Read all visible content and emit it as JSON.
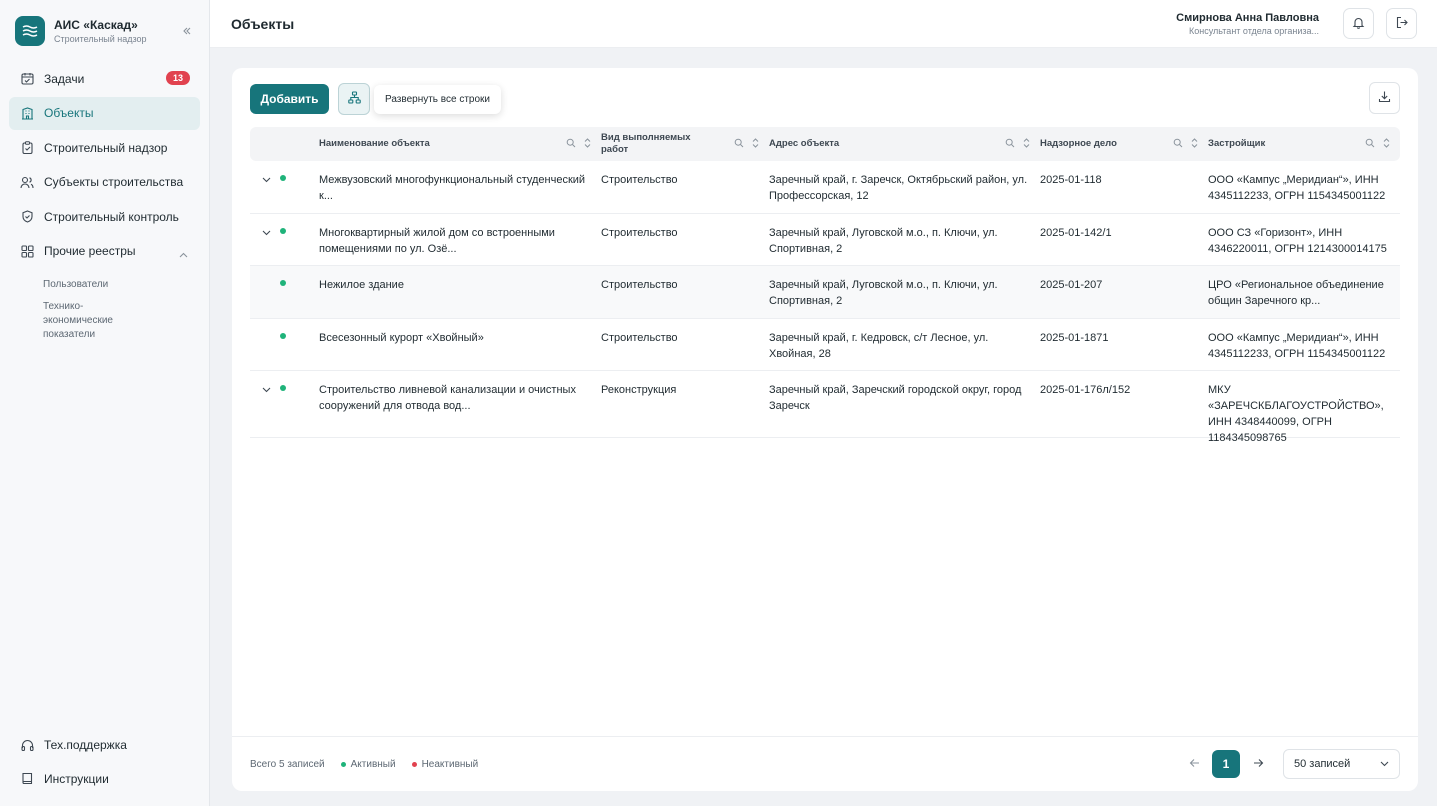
{
  "brand": {
    "title": "АИС «Каскад»",
    "subtitle": "Строительный надзор"
  },
  "sidebar": {
    "items": [
      {
        "label": "Задачи",
        "icon": "calendar-check-icon",
        "badge": "13"
      },
      {
        "label": "Объекты",
        "icon": "building-icon",
        "active": true
      },
      {
        "label": "Строительный надзор",
        "icon": "clipboard-icon"
      },
      {
        "label": "Субъекты строительства",
        "icon": "users-icon"
      },
      {
        "label": "Строительный контроль",
        "icon": "shield-icon"
      },
      {
        "label": "Прочие реестры",
        "icon": "grid-icon",
        "expanded": true
      }
    ],
    "sub_items": [
      "Пользователи",
      "Технико-экономические показатели"
    ],
    "bottom": [
      {
        "label": "Тех.поддержка",
        "icon": "headphones-icon"
      },
      {
        "label": "Инструкции",
        "icon": "book-icon"
      }
    ]
  },
  "header": {
    "title": "Объекты",
    "user_name": "Смирнова Анна Павловна",
    "user_role": "Консультант отдела организа..."
  },
  "toolbar": {
    "add_label": "Добавить",
    "tooltip": "Развернуть все строки"
  },
  "table": {
    "columns": [
      "Наименование объекта",
      "Вид выполняемых работ",
      "Адрес объекта",
      "Надзорное дело",
      "Застройщик"
    ],
    "rows": [
      {
        "expandable": true,
        "status": "active",
        "name": "Межвузовский многофункциональный студенческий к...",
        "work": "Строительство",
        "address": "Заречный край, г. Заречск, Октябрьский район, ул. Профессорская, 12",
        "case": "2025-01-118",
        "developer": "ООО «Кампус „Меридиан“», ИНН 4345112233, ОГРН 1154345001122"
      },
      {
        "expandable": true,
        "status": "active",
        "name": "Многоквартирный жилой дом со встроенными помещениями по ул. Озё...",
        "work": "Строительство",
        "address": "Заречный край, Луговской м.о., п. Ключи, ул. Спортивная, 2",
        "case": "2025-01-142/1",
        "developer": "ООО СЗ «Горизонт», ИНН 4346220011, ОГРН 1214300014175"
      },
      {
        "expandable": false,
        "status": "active",
        "name": "Нежилое здание",
        "work": "Строительство",
        "address": "Заречный край, Луговской м.о., п. Ключи, ул. Спортивная, 2",
        "case": "2025-01-207",
        "developer": "ЦРО «Региональное объединение общин Заречного кр..."
      },
      {
        "expandable": false,
        "status": "active",
        "name": "Всесезонный курорт «Хвойный»",
        "work": "Строительство",
        "address": "Заречный край, г. Кедровск, с/т Лесное, ул. Хвойная, 28",
        "case": "2025-01-1871",
        "developer": "ООО «Кампус „Меридиан“», ИНН 4345112233, ОГРН 1154345001122"
      },
      {
        "expandable": true,
        "status": "active",
        "name": "Строительство ливневой канализации и очистных сооружений для отвода вод...",
        "work": "Реконструкция",
        "address": "Заречный край, Заречский городской округ, город Заречск",
        "case": "2025-01-176л/152",
        "developer": "МКУ «ЗАРЕЧСКБЛАГОУСТРОЙСТВО», ИНН 4348440099, ОГРН 1184345098765"
      }
    ]
  },
  "footer": {
    "total": "Всего 5 записей",
    "legend_active": "Активный",
    "legend_inactive": "Неактивный",
    "page": "1",
    "per_page": "50 записей"
  },
  "colors": {
    "accent": "#17757b",
    "active": "#1fb37a",
    "inactive": "#e1424f",
    "badge": "#e1424f"
  }
}
